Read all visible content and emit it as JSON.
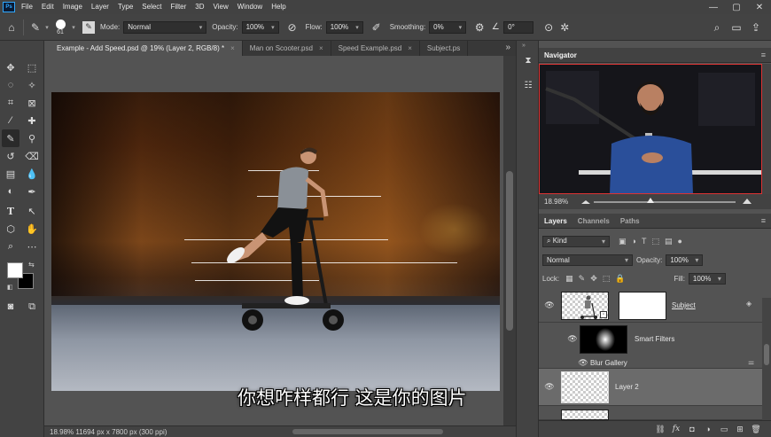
{
  "app": {
    "logo": "Ps"
  },
  "menu": [
    "File",
    "Edit",
    "Image",
    "Layer",
    "Type",
    "Select",
    "Filter",
    "3D",
    "View",
    "Window",
    "Help"
  ],
  "window_controls": {
    "minimize": "—",
    "maximize": "▢",
    "close": "✕"
  },
  "options_bar": {
    "brush_size": "61",
    "mode_label": "Mode:",
    "mode_value": "Normal",
    "opacity_label": "Opacity:",
    "opacity_value": "100%",
    "flow_label": "Flow:",
    "flow_value": "100%",
    "smoothing_label": "Smoothing:",
    "smoothing_value": "0%",
    "angle_value": "0°"
  },
  "tabs": [
    {
      "label": "Example - Add Speed.psd @ 19% (Layer 2, RGB/8) *",
      "active": true
    },
    {
      "label": "Man on Scooter.psd",
      "active": false
    },
    {
      "label": "Speed Example.psd",
      "active": false
    },
    {
      "label": "Subject.ps",
      "active": false
    }
  ],
  "tabs_overflow": "»",
  "status_bar": {
    "info": "18.98%  11694 px x 7800 px (300 ppi)"
  },
  "subtitle": "你想咋样都行 这是你的图片",
  "navigator": {
    "title": "Navigator",
    "zoom": "18.98%"
  },
  "layers_panel": {
    "tabs": [
      "Layers",
      "Channels",
      "Paths"
    ],
    "filter_kind": "Kind",
    "blend_mode": "Normal",
    "opacity_label": "Opacity:",
    "opacity_value": "100%",
    "lock_label": "Lock:",
    "fill_label": "Fill:",
    "fill_value": "100%",
    "layers": [
      {
        "name": "Subject",
        "type": "smart-object"
      },
      {
        "name": "Smart Filters",
        "type": "smart-filters"
      },
      {
        "name": "Blur Gallery",
        "type": "filter"
      },
      {
        "name": "Layer 2",
        "type": "pixel",
        "selected": true
      }
    ],
    "footer_icons": [
      "link-icon",
      "fx-icon",
      "mask-icon",
      "adjustment-icon",
      "group-icon",
      "new-layer-icon",
      "trash-icon"
    ],
    "fx_label": "fx"
  },
  "colors": {
    "accent": "#31a8ff",
    "foreground": "#ffffff",
    "background": "#000000"
  }
}
